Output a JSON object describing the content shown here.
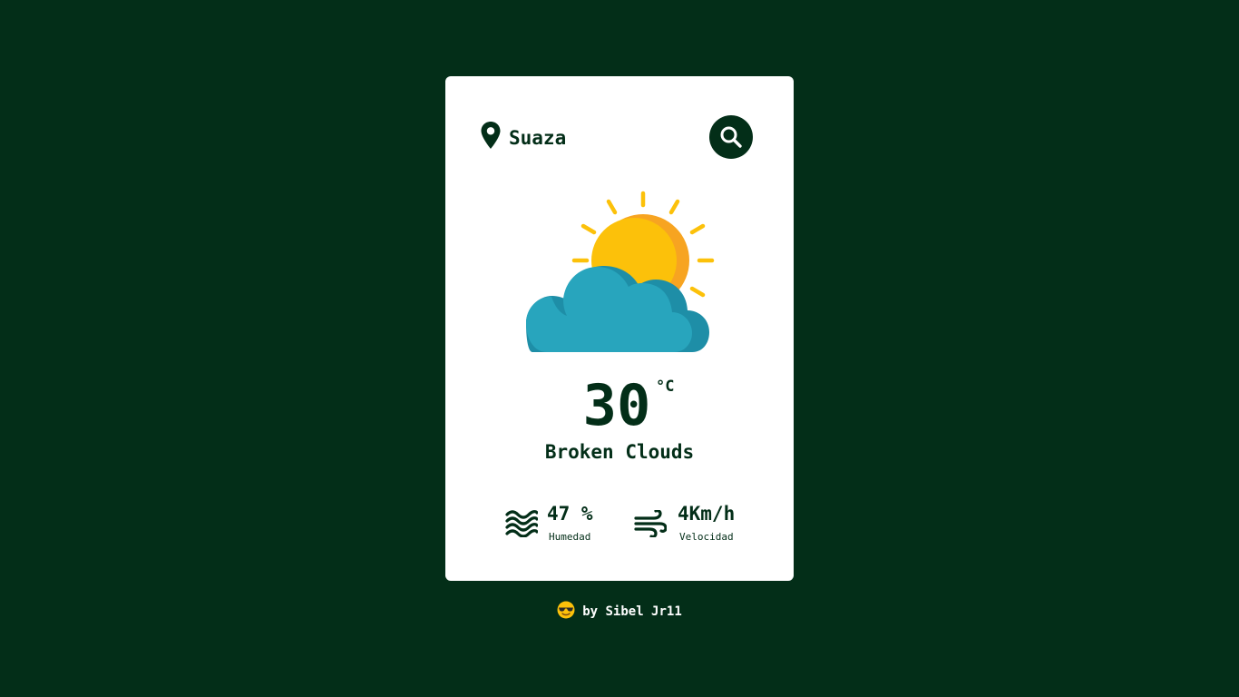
{
  "search": {
    "city_value": "Suaza",
    "placeholder": ""
  },
  "weather": {
    "temperature": "30",
    "unit": "°C",
    "description": "Broken Clouds",
    "icon": "sun-behind-cloud-icon"
  },
  "stats": {
    "humidity": {
      "value": "47 %",
      "label": "Humedad",
      "icon": "waves-icon"
    },
    "wind": {
      "value": "4Km/h",
      "label": "Velocidad",
      "icon": "wind-icon"
    }
  },
  "footer": {
    "text": "by Sibel Jr11",
    "emoji": "sunglasses-face-icon"
  },
  "colors": {
    "background": "#032e18",
    "card": "#ffffff",
    "accent": "#032e18",
    "sun": "#fcc10a",
    "sun_shade": "#f7a421",
    "cloud": "#28a5bd",
    "cloud_shade": "#1e8ea7"
  }
}
